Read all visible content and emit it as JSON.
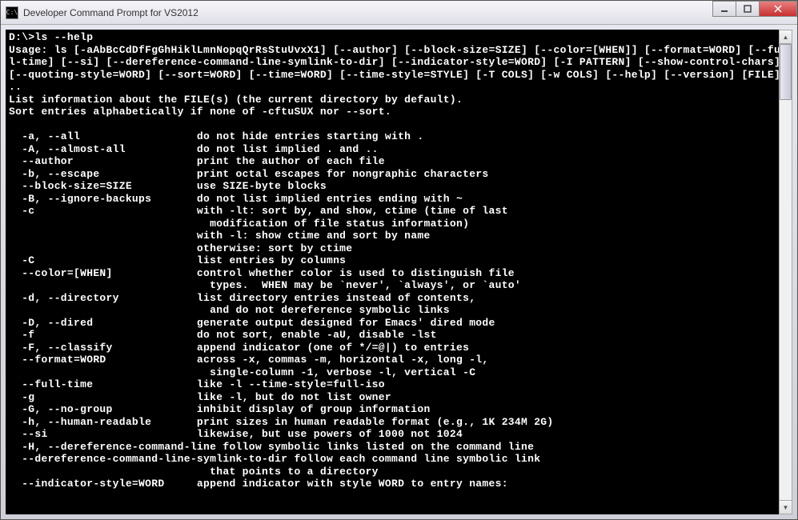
{
  "window": {
    "title": "Developer Command Prompt for VS2012",
    "icon_label": "C:\\"
  },
  "terminal": {
    "prompt": "D:\\>ls --help",
    "lines": [
      "D:\\>ls --help",
      "Usage: ls [-aAbBcCdDfFgGhHiklLmnNopqQrRsStuUvxX1] [--author] [--block-size=SIZE] [--color=[WHEN]] [--format=WORD] [--ful",
      "l-time] [--si] [--dereference-command-line-symlink-to-dir] [--indicator-style=WORD] [-I PATTERN] [--show-control-chars]",
      "[--quoting-style=WORD] [--sort=WORD] [--time=WORD] [--time-style=STYLE] [-T COLS] [-w COLS] [--help] [--version] [FILE].",
      "..",
      "List information about the FILE(s) (the current directory by default).",
      "Sort entries alphabetically if none of -cftuSUX nor --sort.",
      "",
      "  -a, --all                  do not hide entries starting with .",
      "  -A, --almost-all           do not list implied . and ..",
      "  --author                   print the author of each file",
      "  -b, --escape               print octal escapes for nongraphic characters",
      "  --block-size=SIZE          use SIZE-byte blocks",
      "  -B, --ignore-backups       do not list implied entries ending with ~",
      "  -c                         with -lt: sort by, and show, ctime (time of last",
      "                               modification of file status information)",
      "                             with -l: show ctime and sort by name",
      "                             otherwise: sort by ctime",
      "  -C                         list entries by columns",
      "  --color=[WHEN]             control whether color is used to distinguish file",
      "                               types.  WHEN may be `never', `always', or `auto'",
      "  -d, --directory            list directory entries instead of contents,",
      "                               and do not dereference symbolic links",
      "  -D, --dired                generate output designed for Emacs' dired mode",
      "  -f                         do not sort, enable -aU, disable -lst",
      "  -F, --classify             append indicator (one of */=@|) to entries",
      "  --format=WORD              across -x, commas -m, horizontal -x, long -l,",
      "                               single-column -1, verbose -l, vertical -C",
      "  --full-time                like -l --time-style=full-iso",
      "  -g                         like -l, but do not list owner",
      "  -G, --no-group             inhibit display of group information",
      "  -h, --human-readable       print sizes in human readable format (e.g., 1K 234M 2G)",
      "  --si                       likewise, but use powers of 1000 not 1024",
      "  -H, --dereference-command-line follow symbolic links listed on the command line",
      "  --dereference-command-line-symlink-to-dir follow each command line symbolic link",
      "                               that points to a directory",
      "  --indicator-style=WORD     append indicator with style WORD to entry names:"
    ]
  }
}
